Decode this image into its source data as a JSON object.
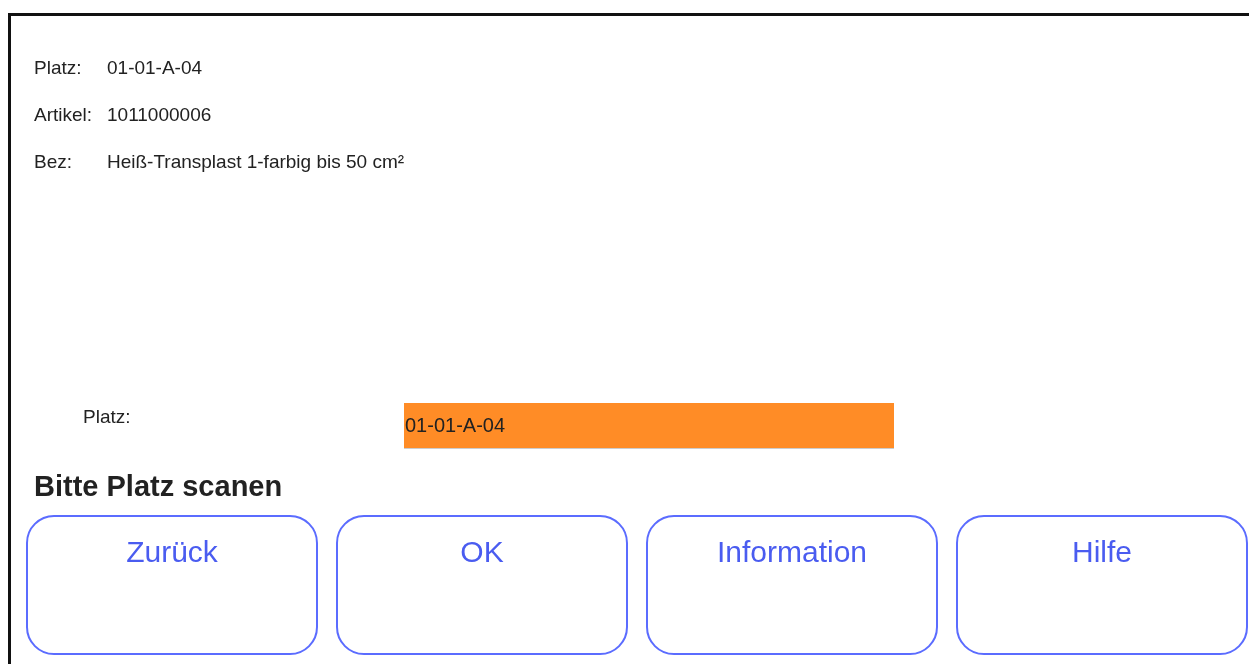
{
  "info": [
    {
      "label": "Platz:",
      "value": "01-01-A-04"
    },
    {
      "label": "Artikel:",
      "value": "1011000006"
    },
    {
      "label": "Bez:",
      "value": "Heiß-Transplast 1-farbig bis 50 cm²"
    }
  ],
  "field": {
    "label": "Platz:",
    "value": "01-01-A-04"
  },
  "prompt": "Bitte Platz scanen",
  "buttons": [
    "Zurück",
    "OK",
    "Information",
    "Hilfe"
  ]
}
